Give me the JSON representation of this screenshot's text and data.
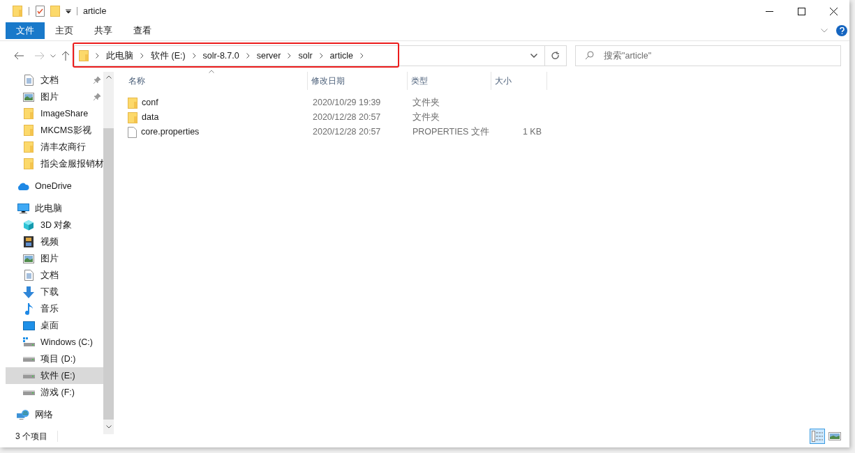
{
  "window": {
    "title": "article"
  },
  "ribbon_tabs": [
    {
      "label": "文件",
      "selected": true
    },
    {
      "label": "主页",
      "selected": false
    },
    {
      "label": "共享",
      "selected": false
    },
    {
      "label": "查看",
      "selected": false
    }
  ],
  "address_bar": {
    "path": [
      "此电脑",
      "软件 (E:)",
      "solr-8.7.0",
      "server",
      "solr",
      "article"
    ],
    "highlighted": true
  },
  "search": {
    "placeholder": "搜索\"article\""
  },
  "sidebar": {
    "quick_access": [
      {
        "label": "文档",
        "kind": "document",
        "pinned": true,
        "selected": false
      },
      {
        "label": "图片",
        "kind": "picture",
        "pinned": true,
        "selected": false
      },
      {
        "label": "ImageShare",
        "kind": "folder",
        "pinned": false,
        "selected": false
      },
      {
        "label": "MKCMS影视",
        "kind": "folder",
        "pinned": false,
        "selected": false
      },
      {
        "label": "清丰农商行",
        "kind": "folder",
        "pinned": false,
        "selected": false
      },
      {
        "label": "指尖金服报销材",
        "kind": "folder",
        "pinned": false,
        "selected": false
      }
    ],
    "roots": [
      {
        "label": "OneDrive",
        "kind": "cloud",
        "selected": false
      },
      {
        "label": "此电脑",
        "kind": "pc",
        "selected": false,
        "children": [
          {
            "label": "3D 对象",
            "kind": "cube",
            "selected": false
          },
          {
            "label": "视频",
            "kind": "video",
            "selected": false
          },
          {
            "label": "图片",
            "kind": "picture",
            "selected": false
          },
          {
            "label": "文档",
            "kind": "document",
            "selected": false
          },
          {
            "label": "下载",
            "kind": "download",
            "selected": false
          },
          {
            "label": "音乐",
            "kind": "music",
            "selected": false
          },
          {
            "label": "桌面",
            "kind": "desktop",
            "selected": false
          },
          {
            "label": "Windows (C:)",
            "kind": "system",
            "selected": false
          },
          {
            "label": "项目 (D:)",
            "kind": "drive",
            "selected": false
          },
          {
            "label": "软件 (E:)",
            "kind": "drive",
            "selected": true
          },
          {
            "label": "游戏 (F:)",
            "kind": "drive",
            "selected": false
          }
        ]
      },
      {
        "label": "网络",
        "kind": "network",
        "selected": false
      }
    ]
  },
  "table": {
    "columns": [
      "名称",
      "修改日期",
      "类型",
      "大小"
    ],
    "rows": [
      {
        "name": "conf",
        "kind": "folder",
        "modified": "2020/10/29 19:39",
        "type": "文件夹"
      },
      {
        "name": "data",
        "kind": "folder",
        "modified": "2020/12/28 20:57",
        "type": "文件夹"
      },
      {
        "name": "core.properties",
        "kind": "file",
        "modified": "2020/12/28 20:57",
        "type": "PROPERTIES 文件",
        "size": "1 KB"
      }
    ]
  },
  "status_bar": {
    "item_count": "3 个项目",
    "view_buttons": [
      {
        "kind": "details",
        "selected": true
      },
      {
        "kind": "thumbnails",
        "selected": false
      }
    ]
  }
}
